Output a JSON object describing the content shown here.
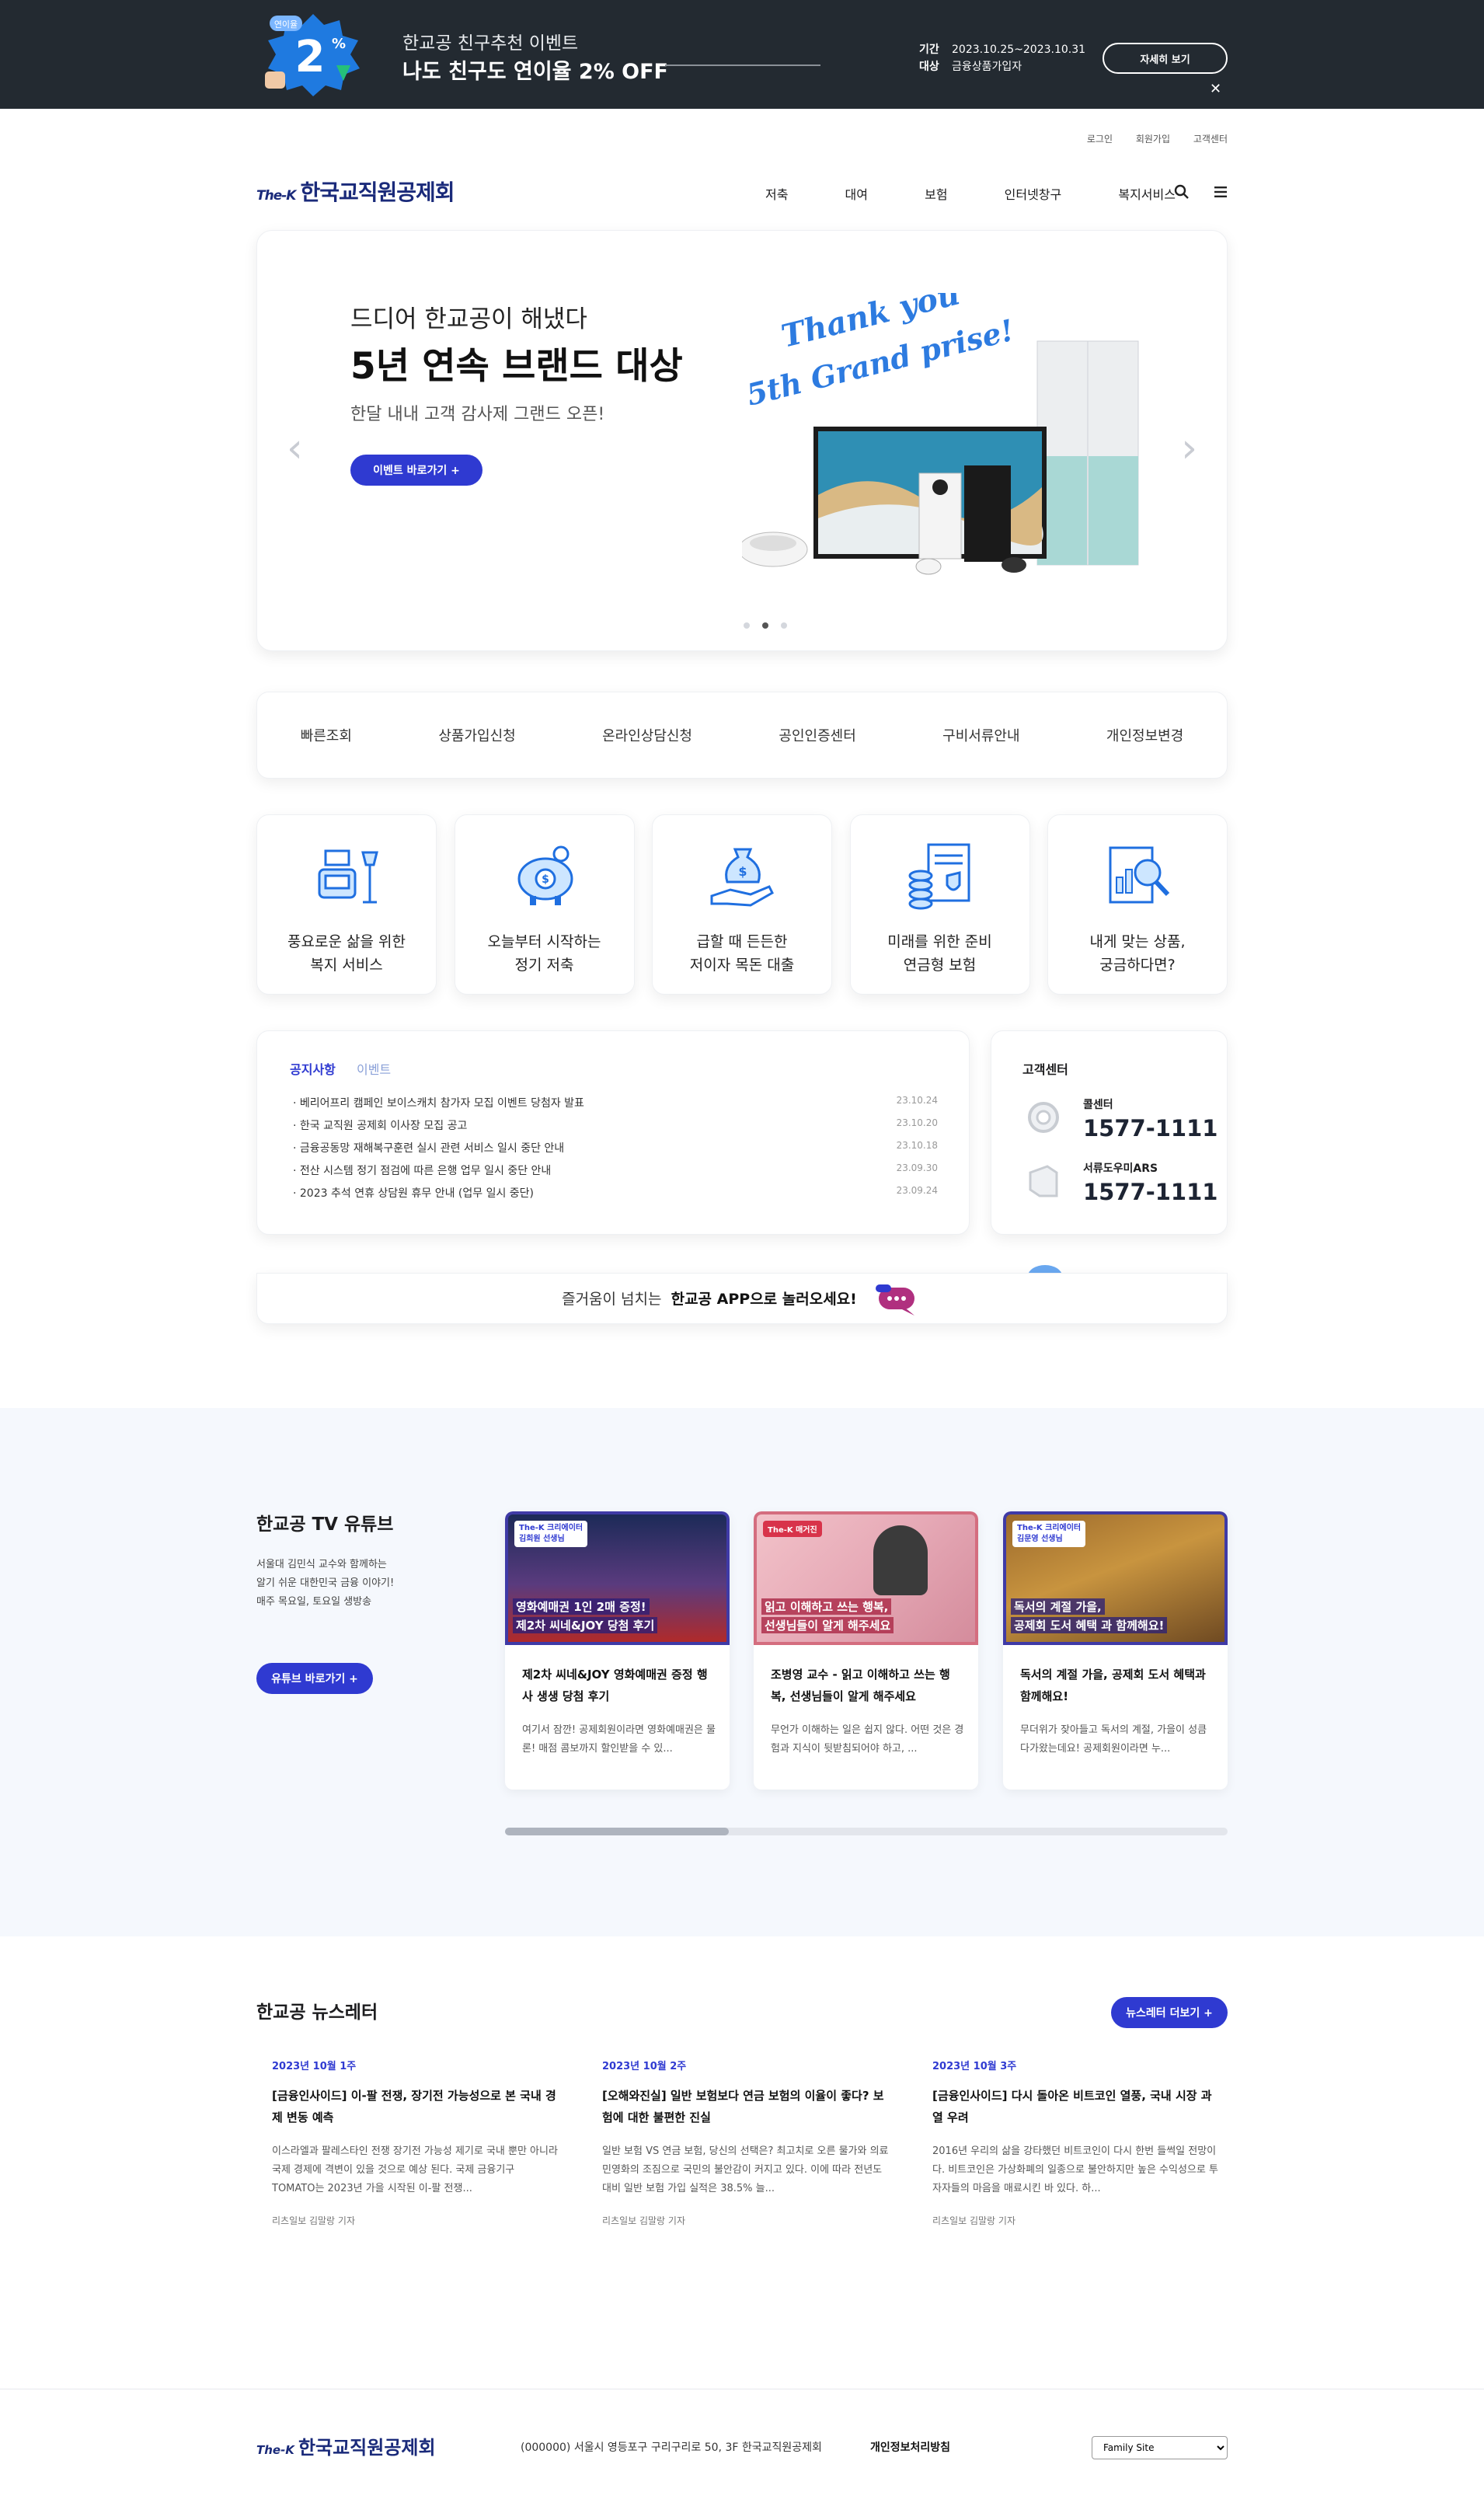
{
  "top_banner": {
    "badge_top": "연이율",
    "badge_number": "2",
    "event_title": "한교공 친구추천 이벤트",
    "event_headline": "나도 친구도 연이율 2% OFF",
    "period_label": "기간",
    "period_value": "2023.10.25~2023.10.31",
    "target_label": "대상",
    "target_value": "금융상품가입자",
    "detail_button": "자세히 보기",
    "close": "✕"
  },
  "util_links": [
    "로그인",
    "회원가입",
    "고객센터"
  ],
  "header": {
    "logo_prefix": "The-K",
    "logo_text": "한국교직원공제회",
    "nav": [
      "저축",
      "대여",
      "보험",
      "인터넷창구",
      "복지서비스"
    ],
    "search_icon": "search-icon",
    "menu_icon": "hamburger-icon"
  },
  "hero": {
    "line1": "드디어 한교공이 해냈다",
    "line2": "5년 연속 브랜드 대상",
    "line3": "한달 내내 고객 감사제 그랜드 오픈!",
    "cta": "이벤트 바로가기 +",
    "script_line1": "Thank you",
    "script_line2": "5th Grand prise!",
    "prev": "‹",
    "next": "›",
    "active_slide_index": 2,
    "slide_count": 3
  },
  "quick_menu": [
    "빠른조회",
    "상품가입신청",
    "온라인상담신청",
    "공인인증센터",
    "구비서류안내",
    "개인정보변경"
  ],
  "services": [
    {
      "line1": "풍요로운 삶을 위한",
      "line2": "복지 서비스",
      "icon": "lounge-icon"
    },
    {
      "line1": "오늘부터 시작하는",
      "line2": "정기 저축",
      "icon": "piggy-bank-icon"
    },
    {
      "line1": "급할 때 든든한",
      "line2": "저이자 목돈 대출",
      "icon": "money-hand-icon"
    },
    {
      "line1": "미래를 위한 준비",
      "line2": "연금형 보험",
      "icon": "insurance-document-icon"
    },
    {
      "line1": "내게 맞는 상품,",
      "line2": "궁금하다면?",
      "icon": "search-report-icon"
    }
  ],
  "notice": {
    "tab_active": "공지사항",
    "tab_other": "이벤트",
    "items": [
      {
        "title": "· 베리어프리 캠페인 보이스캐치 참가자 모집 이벤트 당첨자 발표",
        "date": "23.10.24"
      },
      {
        "title": "· 한국 교직원 공제회 이사장 모집 공고",
        "date": "23.10.20"
      },
      {
        "title": "· 금융공동망 재해복구훈련 실시 관련 서비스 일시 중단 안내",
        "date": "23.10.18"
      },
      {
        "title": "· 전산 시스템 정기 점검에 따른 은행 업무 일시 중단 안내",
        "date": "23.09.30"
      },
      {
        "title": "· 2023 추석 연휴 상담원 휴무 안내 (업무 일시 중단)",
        "date": "23.09.24"
      }
    ]
  },
  "customer_center": {
    "title": "고객센터",
    "call_label": "콜센터",
    "call_number": "1577-1111",
    "ars_label": "서류도우미ARS",
    "ars_number": "1577-1111"
  },
  "app_bar": {
    "text_before": "즐거움이 넘치는",
    "text_bold": "한교공 APP으로 놀러오세요!"
  },
  "youtube": {
    "title": "한교공 TV 유튜브",
    "desc_line1": "서울대 김민식 교수와 함께하는",
    "desc_line2": "알기 쉬운 대한민국 금융 이야기!",
    "desc_line3": "매주 목요일, 토요일 생방송",
    "button": "유튜브 바로가기 +",
    "videos": [
      {
        "thumb_tag": "The-K 크리에이터",
        "thumb_name": "김희원 선생님",
        "thumb_caption1": "영화예매권 1인 2매 증정!",
        "thumb_caption2": "제2차 씨네&JOY 당첨 후기",
        "title": "제2차 씨네&JOY 영화예매권 증정 행사 생생 당첨 후기",
        "desc": "여기서 잠깐! 공제회원이라면 영화예매권은 물론! 매점 콤보까지 할인받을 수 있..."
      },
      {
        "thumb_tag": "The-K 매거진",
        "thumb_name": "",
        "thumb_caption1": "읽고 이해하고 쓰는 행복,",
        "thumb_caption2": "선생님들이 알게 해주세요",
        "title": "조병영 교수 - 읽고 이해하고 쓰는 행복, 선생님들이 알게 해주세요",
        "desc": "무언가 이해하는 일은 쉽지 않다. 어떤 것은 경험과 지식이 뒷받침되어야 하고, ..."
      },
      {
        "thumb_tag": "The-K 크리에이터",
        "thumb_name": "김문영 선생님",
        "thumb_caption1": "독서의 계절 가을,",
        "thumb_caption2": "공제회 도서 혜택 과 함께해요!",
        "title": "독서의 계절 가을, 공제회 도서 혜택과 함께해요!",
        "desc": "무더위가 잦아들고 독서의 계절, 가을이 성큼 다가왔는데요! 공제회원이라면 누..."
      }
    ],
    "scroll_fraction": 0.31
  },
  "newsletter": {
    "title": "한교공 뉴스레터",
    "button": "뉴스레터 더보기 +",
    "items": [
      {
        "date": "2023년 10월 1주",
        "title": "[금융인사이드] 이-팔 전쟁, 장기전 가능성으로 본 국내 경제 변동 예측",
        "desc": "이스라엘과 팔레스타인 전쟁 장기전 가능성 제기로 국내 뿐만 아니라 국제 경제에 격변이 있을 것으로 예상 된다. 국제 금융기구 TOMATO는 2023년 가을 시작된 이-팔 전쟁...",
        "author": "리츠일보 김말랑 기자"
      },
      {
        "date": "2023년 10월 2주",
        "title": "[오해와진실] 일반 보험보다 연금 보험의 이율이 좋다? 보험에 대한 불편한 진실",
        "desc": "일반 보험 VS 연금 보험, 당신의 선택은? 최고치로 오른 물가와 의료 민영화의 조짐으로 국민의 불안감이 커지고 있다. 이에 따라 전년도 대비 일반 보험 가입 실적은 38.5% 늘...",
        "author": "리츠일보 김말랑 기자"
      },
      {
        "date": "2023년 10월 3주",
        "title": "[금융인사이드] 다시 돌아온 비트코인 열풍, 국내 시장 과열 우려",
        "desc": "2016년 우리의 삶을 강타했던 비트코인이 다시 한번 들썩일 전망이다. 비트코인은 가상화폐의 일종으로 불안하지만 높은 수익성으로 투자자들의 마음을 매료시킨 바 있다. 하...",
        "author": "리츠일보 김말랑 기자"
      }
    ]
  },
  "footer": {
    "logo_prefix": "The-K",
    "logo_text": "한국교직원공제회",
    "address": "(000000) 서울시 영등포구 구리구리로 50, 3F 한국교직원공제회",
    "privacy": "개인정보처리방침",
    "family_site": "Family Site"
  },
  "colors": {
    "brand_blue": "#2f3ad1",
    "banner_bg": "#232a31",
    "logo_navy": "#1a2a7a",
    "section_bg": "#f5f8fd"
  }
}
